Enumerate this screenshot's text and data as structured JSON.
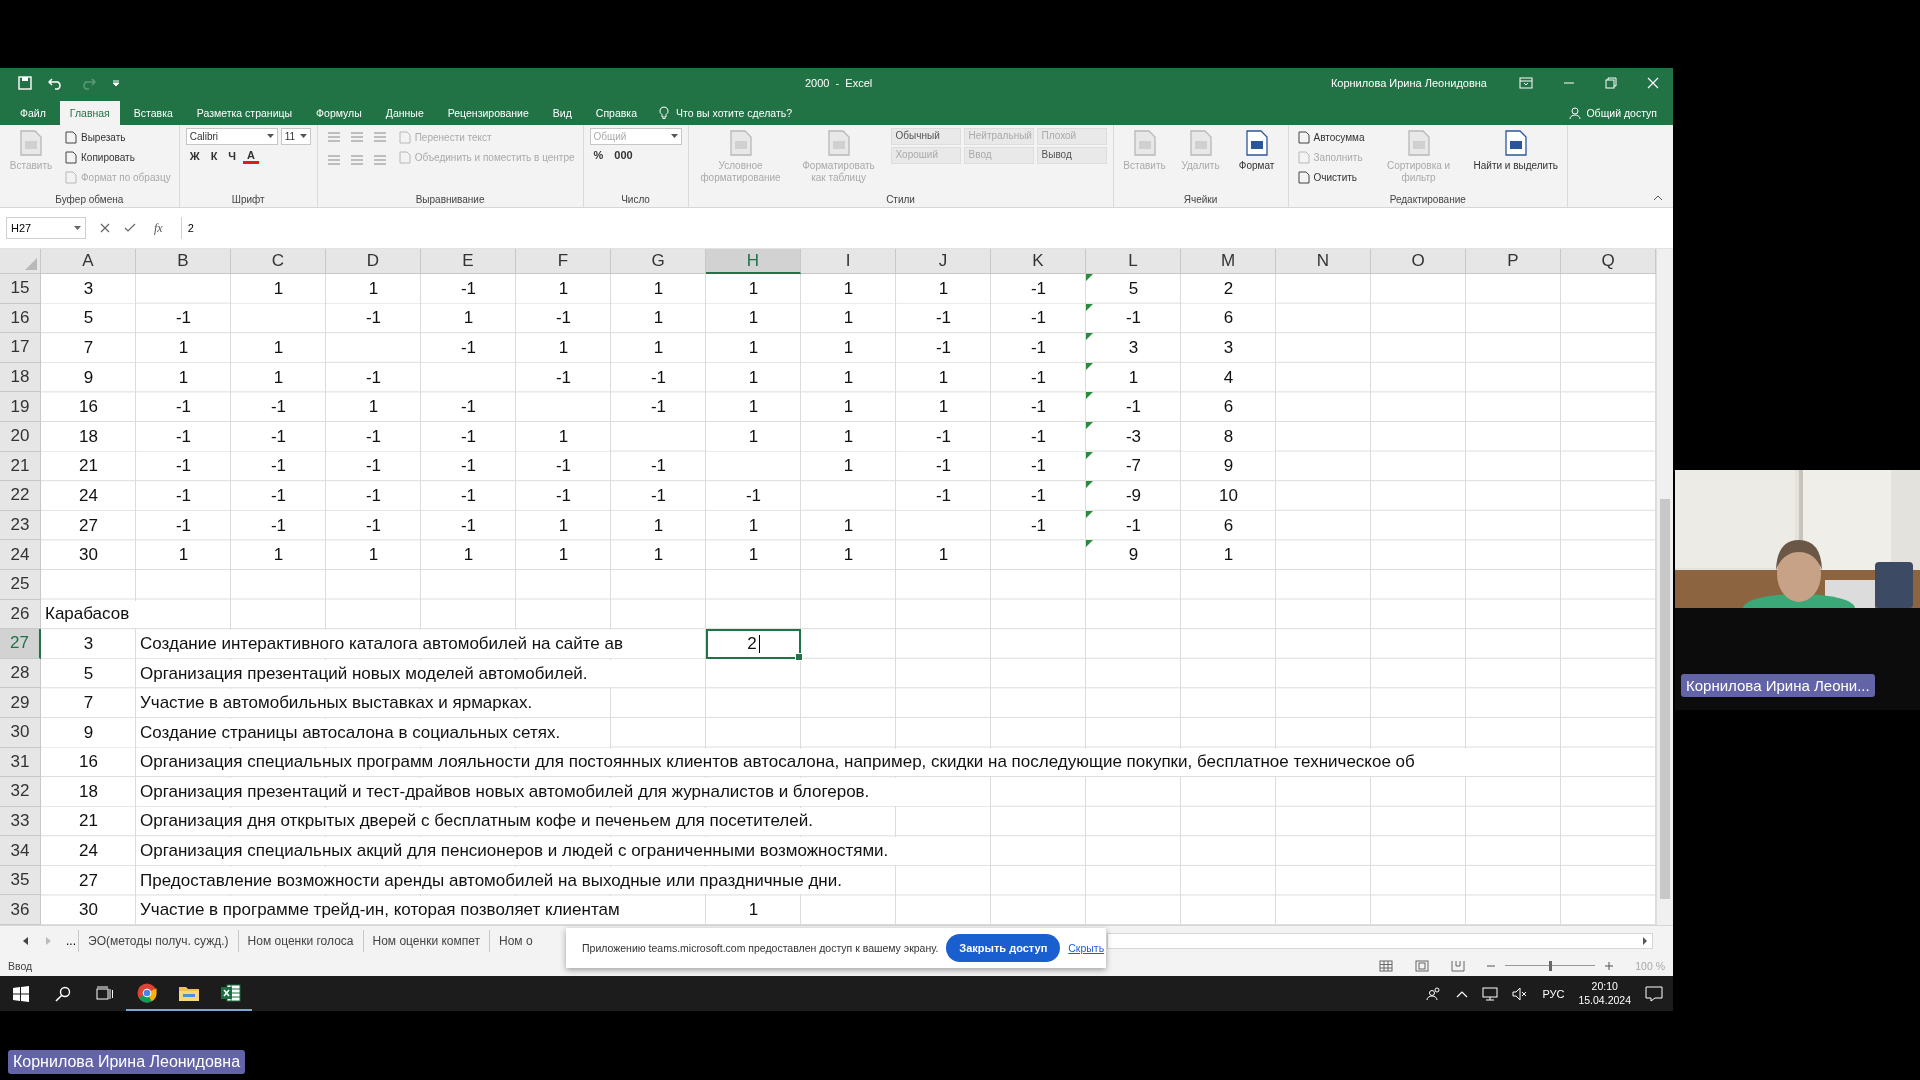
{
  "window": {
    "title": "2000  -  Excel",
    "user": "Корнилова Ирина Леонидовна"
  },
  "ribbon_tabs": [
    {
      "label": "Файл",
      "selected": false
    },
    {
      "label": "Главная",
      "selected": true
    },
    {
      "label": "Вставка",
      "selected": false
    },
    {
      "label": "Разметка страницы",
      "selected": false
    },
    {
      "label": "Формулы",
      "selected": false
    },
    {
      "label": "Данные",
      "selected": false
    },
    {
      "label": "Рецензирование",
      "selected": false
    },
    {
      "label": "Вид",
      "selected": false
    },
    {
      "label": "Справка",
      "selected": false
    }
  ],
  "tell_me": {
    "placeholder": "Что вы хотите сделать?"
  },
  "share": {
    "label": "Общий доступ"
  },
  "ribbon": {
    "groups": [
      {
        "label": "Буфер обмена",
        "sections": [
          {
            "lines": [
              [
                {
                  "kind": "large",
                  "label": "Вставить",
                  "disabled": true
                }
              ]
            ]
          },
          {
            "lines": [
              [
                {
                  "kind": "small",
                  "label": "Вырезать",
                  "disabled": false
                }
              ],
              [
                {
                  "kind": "small",
                  "label": "Копировать",
                  "disabled": false
                }
              ],
              [
                {
                  "kind": "small",
                  "label": "Формат по образцу",
                  "disabled": true
                }
              ]
            ]
          }
        ]
      },
      {
        "label": "Шрифт",
        "sections": [
          {
            "lines": [
              [
                {
                  "kind": "field",
                  "label": "Calibri",
                  "disabled": false
                },
                {
                  "kind": "field",
                  "label": "11",
                  "disabled": false
                }
              ],
              [
                {
                  "kind": "glyph",
                  "label": "Ж",
                  "disabled": false
                },
                {
                  "kind": "glyph",
                  "label": "К",
                  "disabled": false
                },
                {
                  "kind": "glyph",
                  "label": "Ч",
                  "disabled": false
                },
                {
                  "kind": "fontcolor",
                  "label": "А",
                  "disabled": false
                }
              ]
            ]
          }
        ]
      },
      {
        "label": "Выравнивание",
        "sections": [
          {
            "lines": [
              [
                {
                  "kind": "align"
                },
                {
                  "kind": "align"
                },
                {
                  "kind": "align"
                }
              ],
              [
                {
                  "kind": "align"
                },
                {
                  "kind": "align"
                },
                {
                  "kind": "align"
                }
              ]
            ]
          },
          {
            "lines": [
              [
                {
                  "kind": "small",
                  "label": "Перенести текст",
                  "disabled": true
                }
              ],
              [
                {
                  "kind": "small",
                  "label": "Объединить и поместить в центре",
                  "disabled": true
                }
              ]
            ]
          }
        ]
      },
      {
        "label": "Число",
        "sections": [
          {
            "lines": [
              [
                {
                  "kind": "field",
                  "label": "Общий",
                  "disabled": true
                }
              ],
              [
                {
                  "kind": "glyph",
                  "label": "%",
                  "disabled": false
                },
                {
                  "kind": "glyph",
                  "label": "000",
                  "disabled": false
                }
              ]
            ]
          }
        ]
      },
      {
        "label": "Стили",
        "sections": [
          {
            "lines": [
              [
                {
                  "kind": "large",
                  "label": "Условное форматирование",
                  "disabled": true
                }
              ]
            ]
          },
          {
            "lines": [
              [
                {
                  "kind": "large",
                  "label": "Форматировать как таблицу",
                  "disabled": true
                }
              ]
            ]
          },
          {
            "lines": [
              [
                {
                  "kind": "style",
                  "label": "Обычный",
                  "disabled": false
                },
                {
                  "kind": "style",
                  "label": "Нейтральный",
                  "disabled": true
                },
                {
                  "kind": "style",
                  "label": "Плохой",
                  "disabled": true
                }
              ],
              [
                {
                  "kind": "style",
                  "label": "Хороший",
                  "disabled": true
                },
                {
                  "kind": "style",
                  "label": "Ввод",
                  "disabled": true
                },
                {
                  "kind": "style",
                  "label": "Вывод",
                  "disabled": false
                }
              ]
            ]
          }
        ]
      },
      {
        "label": "Ячейки",
        "sections": [
          {
            "lines": [
              [
                {
                  "kind": "large",
                  "label": "Вставить",
                  "disabled": true
                }
              ]
            ]
          },
          {
            "lines": [
              [
                {
                  "kind": "large",
                  "label": "Удалить",
                  "disabled": true
                }
              ]
            ]
          },
          {
            "lines": [
              [
                {
                  "kind": "large",
                  "label": "Формат",
                  "disabled": false
                }
              ]
            ]
          }
        ]
      },
      {
        "label": "Редактирование",
        "sections": [
          {
            "lines": [
              [
                {
                  "kind": "small",
                  "label": "Автосумма",
                  "disabled": false
                }
              ],
              [
                {
                  "kind": "small",
                  "label": "Заполнить",
                  "disabled": true
                }
              ],
              [
                {
                  "kind": "small",
                  "label": "Очистить",
                  "disabled": false
                }
              ]
            ]
          },
          {
            "lines": [
              [
                {
                  "kind": "large",
                  "label": "Сортировка и фильтр",
                  "disabled": true
                }
              ]
            ]
          },
          {
            "lines": [
              [
                {
                  "kind": "large",
                  "label": "Найти и выделить",
                  "disabled": false
                }
              ]
            ]
          }
        ]
      }
    ]
  },
  "formula_bar": {
    "name_box": "H27",
    "function_label": "fx",
    "value": "2"
  },
  "sheet": {
    "columns": [
      {
        "label": "A",
        "selected": false
      },
      {
        "label": "B",
        "selected": false
      },
      {
        "label": "C",
        "selected": false
      },
      {
        "label": "D",
        "selected": false
      },
      {
        "label": "E",
        "selected": false
      },
      {
        "label": "F",
        "selected": false
      },
      {
        "label": "G",
        "selected": false
      },
      {
        "label": "H",
        "selected": true
      },
      {
        "label": "I",
        "selected": false
      },
      {
        "label": "J",
        "selected": false
      },
      {
        "label": "K",
        "selected": false
      },
      {
        "label": "L",
        "selected": false
      },
      {
        "label": "M",
        "selected": false
      },
      {
        "label": "N",
        "selected": false
      },
      {
        "label": "O",
        "selected": false
      },
      {
        "label": "P",
        "selected": false
      },
      {
        "label": "Q",
        "selected": false
      }
    ],
    "rows": [
      {
        "number": "15",
        "kind": "numbers",
        "selected": false,
        "flagged": true,
        "cells": [
          "3",
          "",
          "1",
          "1",
          "-1",
          "1",
          "1",
          "1",
          "1",
          "1",
          "-1",
          "5",
          "2"
        ]
      },
      {
        "number": "16",
        "kind": "numbers",
        "selected": false,
        "flagged": true,
        "cells": [
          "5",
          "-1",
          "",
          "-1",
          "1",
          "-1",
          "1",
          "1",
          "1",
          "-1",
          "-1",
          "-1",
          "6"
        ]
      },
      {
        "number": "17",
        "kind": "numbers",
        "selected": false,
        "flagged": true,
        "cells": [
          "7",
          "1",
          "1",
          "",
          "-1",
          "1",
          "1",
          "1",
          "1",
          "-1",
          "-1",
          "3",
          "3"
        ]
      },
      {
        "number": "18",
        "kind": "numbers",
        "selected": false,
        "flagged": true,
        "cells": [
          "9",
          "1",
          "1",
          "-1",
          "",
          "-1",
          "-1",
          "1",
          "1",
          "1",
          "-1",
          "1",
          "4"
        ]
      },
      {
        "number": "19",
        "kind": "numbers",
        "selected": false,
        "flagged": true,
        "cells": [
          "16",
          "-1",
          "-1",
          "1",
          "-1",
          "",
          "-1",
          "1",
          "1",
          "1",
          "-1",
          "-1",
          "6"
        ]
      },
      {
        "number": "20",
        "kind": "numbers",
        "selected": false,
        "flagged": true,
        "cells": [
          "18",
          "-1",
          "-1",
          "-1",
          "-1",
          "1",
          "",
          "1",
          "1",
          "-1",
          "-1",
          "-3",
          "8"
        ]
      },
      {
        "number": "21",
        "kind": "numbers",
        "selected": false,
        "flagged": true,
        "cells": [
          "21",
          "-1",
          "-1",
          "-1",
          "-1",
          "-1",
          "-1",
          "",
          "1",
          "-1",
          "-1",
          "-7",
          "9"
        ]
      },
      {
        "number": "22",
        "kind": "numbers",
        "selected": false,
        "flagged": true,
        "cells": [
          "24",
          "-1",
          "-1",
          "-1",
          "-1",
          "-1",
          "-1",
          "-1",
          "",
          "-1",
          "-1",
          "-9",
          "10"
        ]
      },
      {
        "number": "23",
        "kind": "numbers",
        "selected": false,
        "flagged": true,
        "cells": [
          "27",
          "-1",
          "-1",
          "-1",
          "-1",
          "1",
          "1",
          "1",
          "1",
          "",
          "-1",
          "-1",
          "6"
        ]
      },
      {
        "number": "24",
        "kind": "numbers",
        "selected": false,
        "flagged": true,
        "cells": [
          "30",
          "1",
          "1",
          "1",
          "1",
          "1",
          "1",
          "1",
          "1",
          "1",
          "",
          "9",
          "1"
        ]
      },
      {
        "number": "25",
        "kind": "blank",
        "selected": false
      },
      {
        "number": "26",
        "kind": "title",
        "selected": false,
        "text": "Карабасов"
      },
      {
        "number": "27",
        "kind": "task",
        "selected": true,
        "id": "3",
        "text": "Создание интерактивного каталога автомобилей на сайте ав",
        "value": "2"
      },
      {
        "number": "28",
        "kind": "task",
        "selected": false,
        "id": "5",
        "text": "Организация презентаций новых моделей автомобилей."
      },
      {
        "number": "29",
        "kind": "task",
        "selected": false,
        "id": "7",
        "text": "Участие в автомобильных выставках и ярмарках."
      },
      {
        "number": "30",
        "kind": "task",
        "selected": false,
        "id": "9",
        "text": "Создание страницы автосалона в социальных сетях."
      },
      {
        "number": "31",
        "kind": "task",
        "selected": false,
        "id": "16",
        "text": "Организация специальных программ лояльности для постоянных клиентов автосалона, например, скидки на последующие покупки, бесплатное техническое об"
      },
      {
        "number": "32",
        "kind": "task",
        "selected": false,
        "id": "18",
        "text": "Организация презентаций и тест-драйвов новых автомобилей для журналистов и блогеров."
      },
      {
        "number": "33",
        "kind": "task",
        "selected": false,
        "id": "21",
        "text": "Организация дня открытых дверей с бесплатным кофе и печеньем для посетителей."
      },
      {
        "number": "34",
        "kind": "task",
        "selected": false,
        "id": "24",
        "text": "Организация специальных акций для пенсионеров и людей с ограниченными возможностями."
      },
      {
        "number": "35",
        "kind": "task",
        "selected": false,
        "id": "27",
        "text": "Предоставление возможности аренды автомобилей на выходные или праздничные дни."
      },
      {
        "number": "36",
        "kind": "task",
        "selected": false,
        "id": "30",
        "text": "Участие в программе трейд-ин, которая позволяет клиентам",
        "value": "1"
      }
    ]
  },
  "sheet_tabs": {
    "more": "...",
    "tabs": [
      {
        "label": "ЭО(методы получ. сужд.)",
        "selected": false
      },
      {
        "label": "Ном оценки голоса",
        "selected": false
      },
      {
        "label": "Ном оценки компет",
        "selected": false
      },
      {
        "label": "Ном о",
        "selected": false
      }
    ]
  },
  "share_notice": {
    "text": "Приложению teams.microsoft.com предоставлен доступ к вашему экрану.",
    "button": "Закрыть доступ",
    "link": "Скрыть"
  },
  "status_bar": {
    "mode": "Ввод",
    "zoom": {
      "level": 0.5,
      "label": "100 %"
    }
  },
  "taskbar": {
    "apps": [
      {
        "kind": "start",
        "running": false
      },
      {
        "kind": "search",
        "running": false
      },
      {
        "kind": "taskview",
        "running": false
      },
      {
        "kind": "browser",
        "running": true
      },
      {
        "kind": "folder",
        "running": true
      },
      {
        "kind": "spreadsheet",
        "running": true
      }
    ],
    "language": "РУС",
    "time": "20:10",
    "date": "15.04.2024"
  },
  "video": {
    "kind": "picture",
    "name": "Корнилова Ирина Леони..."
  },
  "presenter": {
    "name": "Корнилова Ирина Леонидовна"
  }
}
